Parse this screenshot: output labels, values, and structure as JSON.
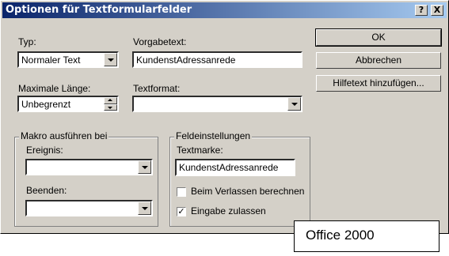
{
  "window": {
    "title": "Optionen für Textformularfelder"
  },
  "title_buttons": {
    "help": "?",
    "close": "X"
  },
  "typ": {
    "label_u": "Typ:",
    "value": "Normaler Text"
  },
  "vorgabetext": {
    "label": "Vorgabetext:",
    "value": "KundenstAdressanrede"
  },
  "max_length": {
    "label": "Maximale Länge:",
    "value": "Unbegrenzt"
  },
  "textformat": {
    "label": "Textformat:",
    "value": ""
  },
  "buttons": {
    "ok": "OK",
    "cancel": "Abbrechen",
    "help_text": "Hilfetext hinzufügen..."
  },
  "macro_group": {
    "title": "Makro ausführen bei",
    "event_label": "Ereignis:",
    "event_value": "",
    "exit_label": "Beenden:",
    "exit_value": ""
  },
  "field_settings": {
    "title": "Feldeinstellungen",
    "bookmark_label": "Textmarke:",
    "bookmark_value": "KundenstAdressanrede",
    "calc_on_exit": {
      "label": "Beim Verlassen berechnen",
      "checked": false
    },
    "allow_input": {
      "label": "Eingabe zulassen",
      "checked": true
    }
  },
  "caption": "Office 2000"
}
